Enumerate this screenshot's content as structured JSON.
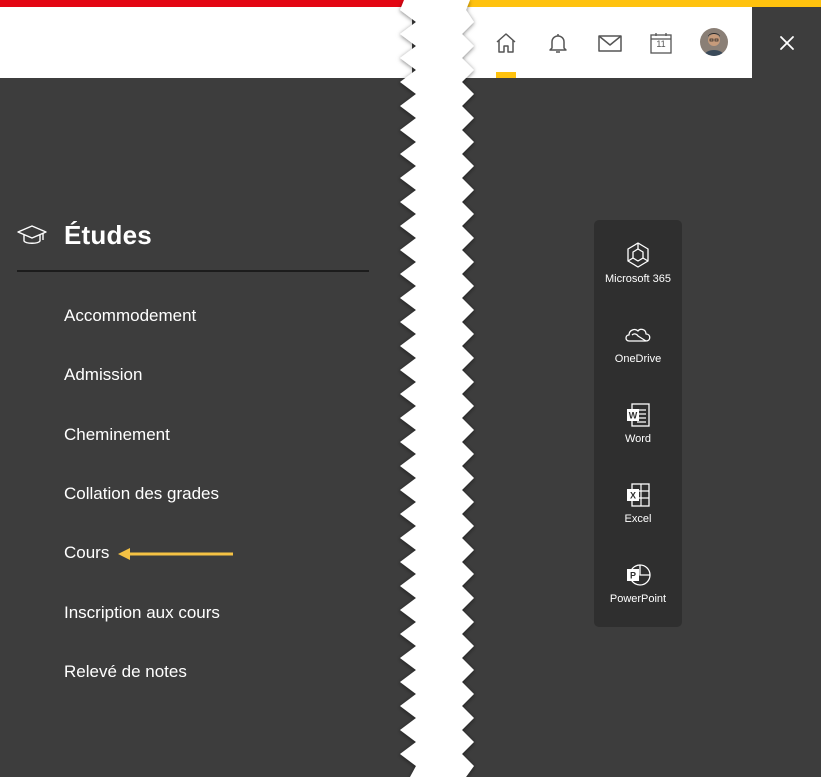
{
  "header": {
    "calendar_day": "11",
    "nav_icons": [
      "home-icon",
      "bell-icon",
      "mail-icon",
      "calendar-icon"
    ],
    "accent_colors": {
      "red": "#e30613",
      "yellow": "#ffc20e"
    }
  },
  "section": {
    "title": "Études",
    "icon": "graduation-cap-icon"
  },
  "menu": {
    "items": [
      {
        "label": "Accommodement"
      },
      {
        "label": "Admission"
      },
      {
        "label": "Cheminement"
      },
      {
        "label": "Collation des grades"
      },
      {
        "label": "Cours"
      },
      {
        "label": "Inscription aux cours"
      },
      {
        "label": "Relevé de notes"
      }
    ]
  },
  "apps": {
    "items": [
      {
        "label": "Microsoft 365",
        "icon": "microsoft-365-icon"
      },
      {
        "label": "OneDrive",
        "icon": "onedrive-icon"
      },
      {
        "label": "Word",
        "icon": "word-icon"
      },
      {
        "label": "Excel",
        "icon": "excel-icon"
      },
      {
        "label": "PowerPoint",
        "icon": "powerpoint-icon"
      }
    ]
  }
}
